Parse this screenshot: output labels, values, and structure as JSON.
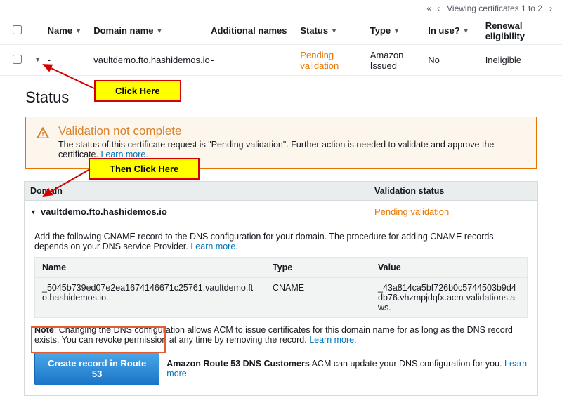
{
  "pager": {
    "label": "Viewing certificates 1 to 2"
  },
  "columns": {
    "name": "Name",
    "domain": "Domain name",
    "additional": "Additional names",
    "status": "Status",
    "type": "Type",
    "inuse": "In use?",
    "renewal": "Renewal eligibility"
  },
  "row": {
    "name": "-",
    "domain": "vaultdemo.fto.hashidemos.io",
    "additional": "-",
    "status": "Pending validation",
    "type": "Amazon Issued",
    "inuse": "No",
    "renewal": "Ineligible"
  },
  "status_heading": "Status",
  "alert": {
    "title": "Validation not complete",
    "body": "The status of this certificate request is \"Pending validation\". Further action is needed to validate and approve the certificate.",
    "learn": "Learn more."
  },
  "domain_table": {
    "col_domain": "Domain",
    "col_valstatus": "Validation status",
    "domain": "vaultdemo.fto.hashidemos.io",
    "valstatus": "Pending validation"
  },
  "cname": {
    "intro": "Add the following CNAME record to the DNS configuration for your domain. The procedure for adding CNAME records depends on your DNS service Provider.",
    "learn": "Learn more.",
    "hdr_name": "Name",
    "hdr_type": "Type",
    "hdr_value": "Value",
    "name": "_5045b739ed07e2ea1674146671c25761.vaultdemo.fto.hashidemos.io.",
    "type": "CNAME",
    "value": "_43a814ca5bf726b0c5744503b9d4db76.vhzmpjdqfx.acm-validations.aws."
  },
  "note": {
    "label": "Note",
    "body": ": Changing the DNS configuration allows ACM to issue certificates for this domain name for as long as the DNS record exists. You can revoke permission at any time by removing the record.",
    "learn": "Learn more."
  },
  "create": {
    "button": "Create record in Route 53",
    "side_bold": "Amazon Route 53 DNS Customers",
    "side_text": " ACM can update your DNS configuration for you.",
    "learn": "Learn more."
  },
  "annot": {
    "click1": "Click Here",
    "click2": "Then Click Here"
  }
}
